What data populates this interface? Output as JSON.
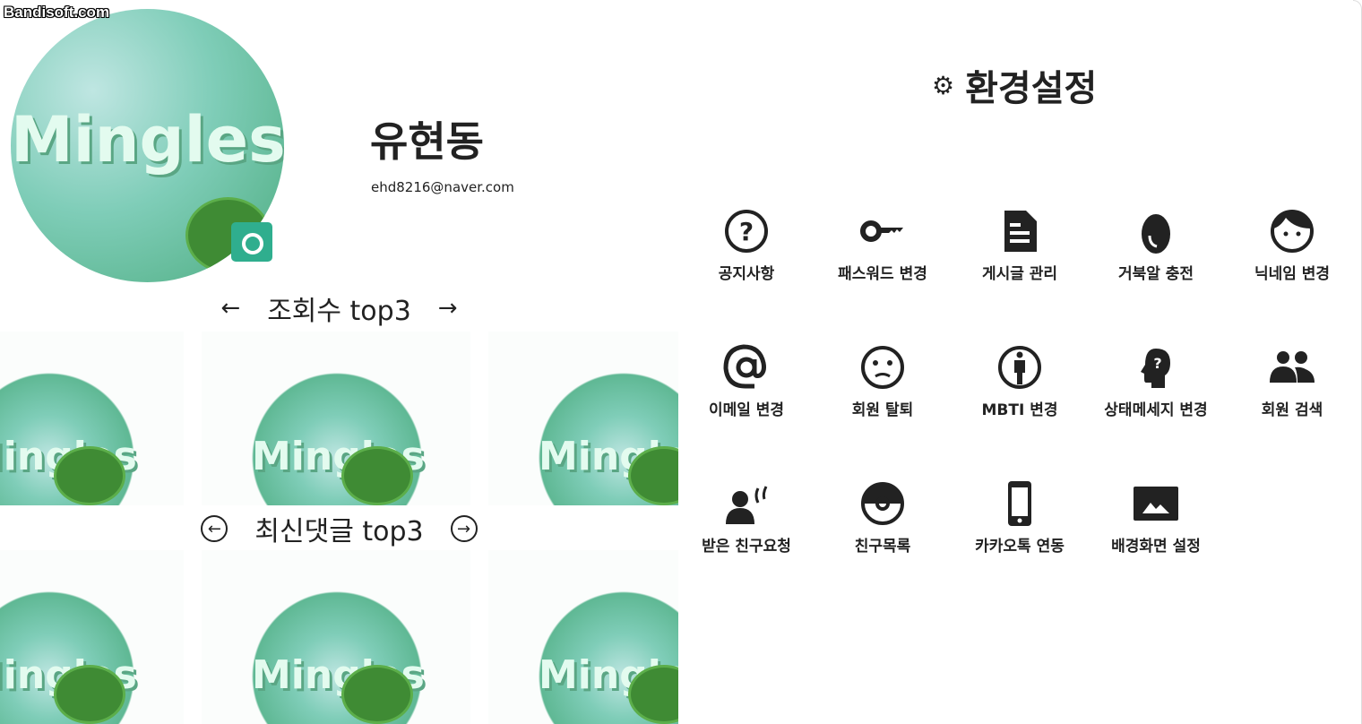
{
  "watermark": "Bandisoft.com",
  "profile": {
    "name": "유현동",
    "email": "ehd8216@naver.com",
    "logo_text": "Mingles"
  },
  "views_section": {
    "title": "조회수 top3",
    "prev": "←",
    "next": "→"
  },
  "comments_section": {
    "title": "최신댓글 top3",
    "prev": "←",
    "next": "→"
  },
  "settings": {
    "icon": "gear-icon",
    "title": "환경설정",
    "gear": "⚙",
    "items": [
      {
        "label": "공지사항",
        "icon": "question-circle-icon"
      },
      {
        "label": "패스워드 변경",
        "icon": "key-icon"
      },
      {
        "label": "게시글 관리",
        "icon": "document-icon"
      },
      {
        "label": "거북알 충전",
        "icon": "egg-icon"
      },
      {
        "label": "닉네임 변경",
        "icon": "face-icon"
      },
      {
        "label": "이메일 변경",
        "icon": "at-icon"
      },
      {
        "label": "회원 탈퇴",
        "icon": "sad-face-icon"
      },
      {
        "label": "MBTI 변경",
        "icon": "info-person-icon"
      },
      {
        "label": "상태메세지 변경",
        "icon": "head-question-icon"
      },
      {
        "label": "회원 검색",
        "icon": "people-icon"
      },
      {
        "label": "받은 친구요청",
        "icon": "person-voice-icon"
      },
      {
        "label": "친구목록",
        "icon": "pokeball-icon"
      },
      {
        "label": "카카오톡 연동",
        "icon": "phone-icon"
      },
      {
        "label": "배경화면 설정",
        "icon": "image-icon"
      }
    ]
  }
}
